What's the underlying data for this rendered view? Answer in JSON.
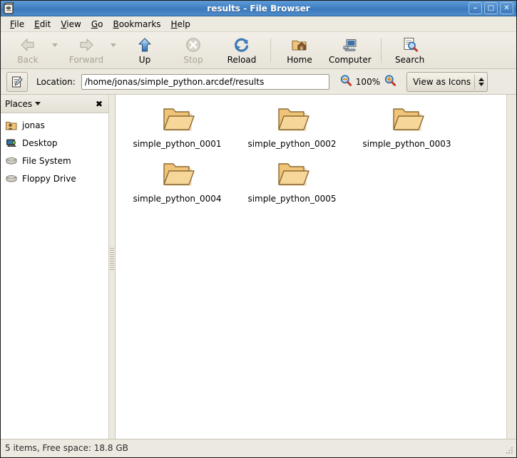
{
  "window": {
    "title": "results - File Browser",
    "icon": "file-browser-icon",
    "controls": [
      {
        "name": "minimize",
        "glyph": "–"
      },
      {
        "name": "maximize",
        "glyph": "□"
      },
      {
        "name": "close",
        "glyph": "✕"
      }
    ]
  },
  "menubar": {
    "items": [
      {
        "accel": "F",
        "rest": "ile"
      },
      {
        "accel": "E",
        "rest": "dit"
      },
      {
        "accel": "V",
        "rest": "iew"
      },
      {
        "accel": "G",
        "rest": "o"
      },
      {
        "accel": "B",
        "rest": "ookmarks"
      },
      {
        "accel": "H",
        "rest": "elp"
      }
    ]
  },
  "toolbar": {
    "back_label": "Back",
    "forward_label": "Forward",
    "up_label": "Up",
    "stop_label": "Stop",
    "reload_label": "Reload",
    "home_label": "Home",
    "computer_label": "Computer",
    "search_label": "Search"
  },
  "locationbar": {
    "toggle_icon": "edit-location-icon",
    "label": "Location:",
    "path": "/home/jonas/simple_python.arcdef/results",
    "placeholder": "Location",
    "zoom_out_icon": "zoom-out-icon",
    "zoom_level": "100%",
    "zoom_in_icon": "zoom-in-icon",
    "view_mode": "View as Icons"
  },
  "sidebar": {
    "header": "Places",
    "close_glyph": "✖",
    "items": [
      {
        "label": "jonas",
        "icon": "home-folder-icon"
      },
      {
        "label": "Desktop",
        "icon": "desktop-icon"
      },
      {
        "label": "File System",
        "icon": "drive-harddisk-icon"
      },
      {
        "label": "Floppy Drive",
        "icon": "drive-floppy-icon"
      }
    ]
  },
  "files": [
    {
      "name": "simple_python_0001",
      "icon": "folder-icon"
    },
    {
      "name": "simple_python_0002",
      "icon": "folder-icon"
    },
    {
      "name": "simple_python_0003",
      "icon": "folder-icon"
    },
    {
      "name": "simple_python_0004",
      "icon": "folder-icon"
    },
    {
      "name": "simple_python_0005",
      "icon": "folder-icon"
    }
  ],
  "statusbar": {
    "text": "5 items, Free space: 18.8 GB"
  },
  "colors": {
    "titlebar": "#4282c4",
    "chrome": "#ece9e0",
    "folder": "#f0c478",
    "folder_outline": "#8a6a33",
    "view_background": "#ffffff"
  }
}
